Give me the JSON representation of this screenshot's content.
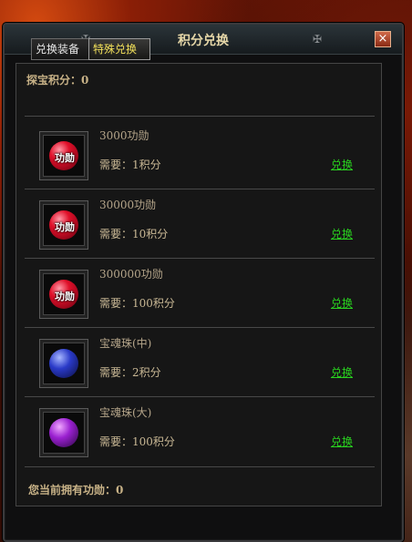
{
  "window": {
    "title": "积分兑换",
    "close_icon": "×",
    "deco_left": "✠",
    "deco_right": "✠"
  },
  "tabs": [
    {
      "label": "兑换装备",
      "active": false
    },
    {
      "label": "特殊兑换",
      "active": true
    }
  ],
  "score": {
    "label": "探宝积分：",
    "value": "0"
  },
  "items": [
    {
      "name": "3000功勋",
      "cost": "需要：1积分",
      "action": "兑换",
      "icon": "merit-orb-icon",
      "icon_text": "功勋"
    },
    {
      "name": "30000功勋",
      "cost": "需要：10积分",
      "action": "兑换",
      "icon": "merit-orb-icon",
      "icon_text": "功勋"
    },
    {
      "name": "300000功勋",
      "cost": "需要：100积分",
      "action": "兑换",
      "icon": "merit-orb-icon",
      "icon_text": "功勋"
    },
    {
      "name": "宝魂珠(中)",
      "cost": "需要：2积分",
      "action": "兑换",
      "icon": "blue-soul-orb-icon",
      "icon_text": ""
    },
    {
      "name": "宝魂珠(大)",
      "cost": "需要：100积分",
      "action": "兑换",
      "icon": "purple-soul-orb-icon",
      "icon_text": ""
    }
  ],
  "owned": {
    "label": "您当前拥有功勋：",
    "value": "0"
  },
  "colors": {
    "link": "#29d21f",
    "active_tab": "#f2e05a",
    "title": "#e6d7a8"
  }
}
